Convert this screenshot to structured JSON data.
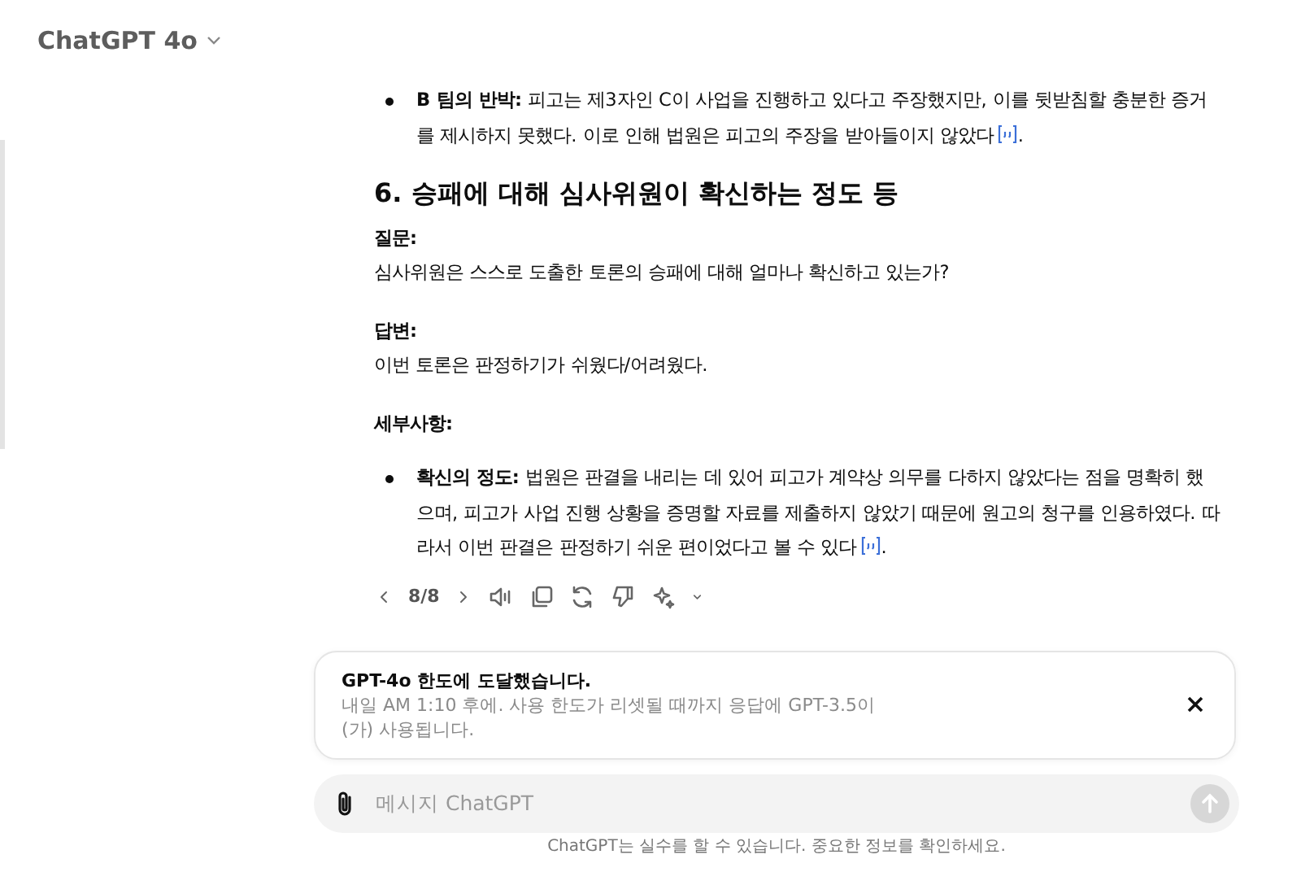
{
  "header": {
    "title": "ChatGPT 4o"
  },
  "message": {
    "bullets_top": [
      {
        "text": "**B 팀의 반박:** 피고는 제3자인 C이 사업을 진행하고 있다고 주장했지만, 이를 뒷받침할 충분한 증거를 제시하지 못했다. 이로 인해 법원은 피고의 주장을 받아들이지 않았다",
        "citation": true,
        "end": "."
      }
    ],
    "heading": "6. 승패에 대해 심사위원이 확신하는 정도 등",
    "sections": [
      {
        "label": "질문:",
        "text": "심사위원은 스스로 도출한 토론의 승패에 대해 얼마나 확신하고 있는가?"
      },
      {
        "label": "답변:",
        "text": "이번 토론은 판정하기가 쉬웠다/어려웠다."
      }
    ],
    "details_label": "세부사항:",
    "bullets": [
      {
        "text": "**확신의 정도:** 법원은 판결을 내리는 데 있어 피고가 계약상 의무를 다하지 않았다는 점을 명확히 했으며, 피고가 사업 진행 상황을 증명할 자료를 제출하지 않았기 때문에 원고의 청구를 인용하였다. 따라서 이번 판결은 판정하기 쉬운 편이었다고 볼 수 있다",
        "citation": true,
        "end": "."
      }
    ],
    "pager": "8/8"
  },
  "notice": {
    "title": "GPT-4o 한도에 도달했습니다.",
    "text": "내일 AM 1:10 후에. 사용 한도가 리셋될 때까지 응답에 GPT-3.5이(가) 사용됩니다."
  },
  "composer": {
    "placeholder": "메시지 ChatGPT"
  },
  "footer": "ChatGPT는 실수를 할 수 있습니다. 중요한 정보를 확인하세요."
}
